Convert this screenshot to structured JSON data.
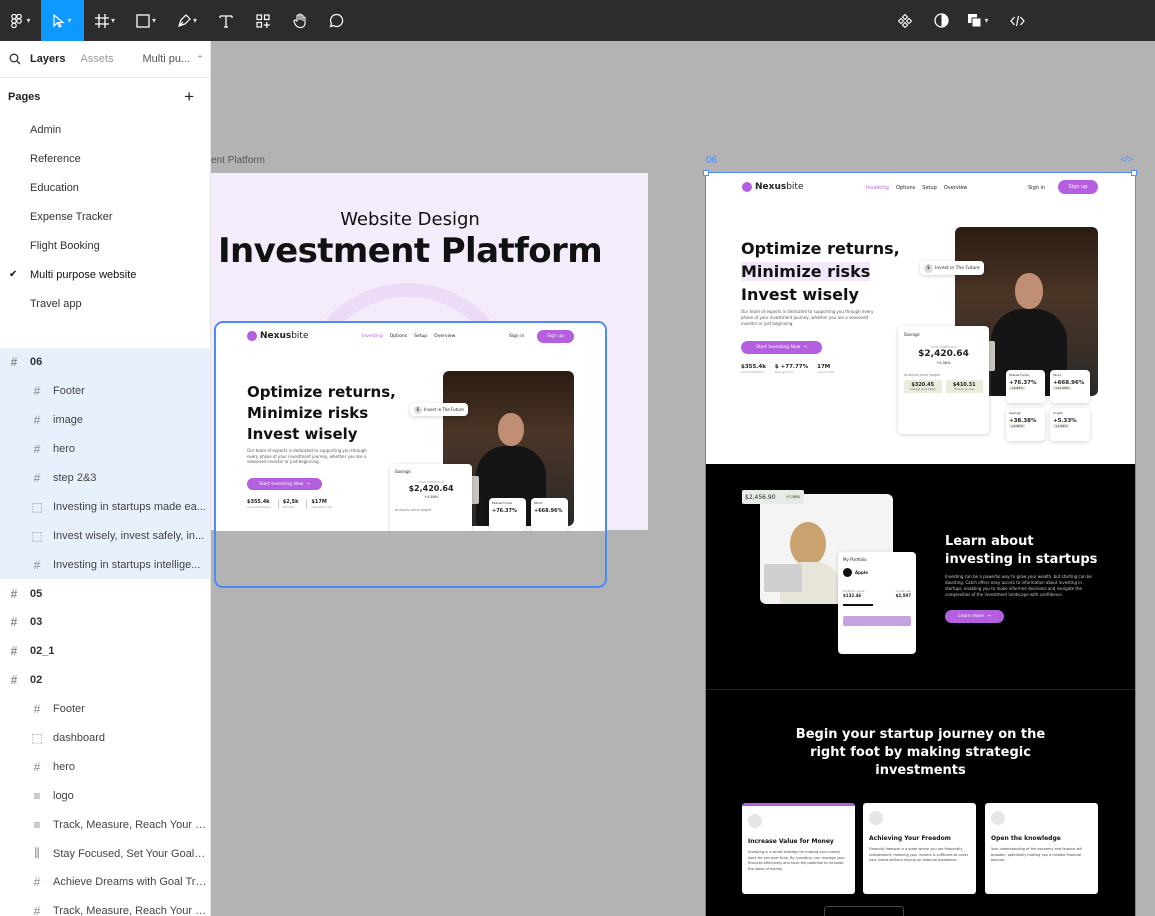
{
  "toolbar": {
    "tools": [
      "main-menu",
      "move",
      "frame",
      "shape",
      "pen",
      "text",
      "resources",
      "hand",
      "comment"
    ],
    "right": [
      "components",
      "contrast",
      "fill",
      "code"
    ]
  },
  "panel": {
    "tabs": {
      "layers": "Layers",
      "assets": "Assets",
      "page": "Multi pu..."
    },
    "pages_title": "Pages",
    "pages": [
      "Admin",
      "Reference",
      "Education",
      "Expense Tracker",
      "Flight Booking",
      "Multi  purpose website",
      "Travel app"
    ],
    "current_page": "Multi  purpose website",
    "layers": [
      {
        "label": "06",
        "level": 0,
        "icon": "#",
        "selected": true
      },
      {
        "label": "Footer",
        "level": 1,
        "icon": "#",
        "selected": true
      },
      {
        "label": "image",
        "level": 1,
        "icon": "#",
        "selected": true
      },
      {
        "label": "hero",
        "level": 1,
        "icon": "#",
        "selected": true
      },
      {
        "label": "step 2&3",
        "level": 1,
        "icon": "#",
        "selected": true
      },
      {
        "label": "Investing in startups made ea...",
        "level": 1,
        "icon": "⬚",
        "selected": true
      },
      {
        "label": "Invest wisely, invest safely, in...",
        "level": 1,
        "icon": "⬚",
        "selected": true
      },
      {
        "label": "Investing in startups intellige...",
        "level": 1,
        "icon": "#",
        "selected": true
      },
      {
        "label": "05",
        "level": 0,
        "icon": "#",
        "selected": false
      },
      {
        "label": "03",
        "level": 0,
        "icon": "#",
        "selected": false
      },
      {
        "label": "02_1",
        "level": 0,
        "icon": "#",
        "selected": false
      },
      {
        "label": "02",
        "level": 0,
        "icon": "#",
        "selected": false
      },
      {
        "label": "Footer",
        "level": 1,
        "icon": "#",
        "selected": false
      },
      {
        "label": "dashboard",
        "level": 1,
        "icon": "⬚",
        "selected": false
      },
      {
        "label": "hero",
        "level": 1,
        "icon": "#",
        "selected": false
      },
      {
        "label": "logo",
        "level": 1,
        "icon": "≡",
        "selected": false
      },
      {
        "label": "Track, Measure, Reach Your G...",
        "level": 1,
        "icon": "≡",
        "selected": false
      },
      {
        "label": "Stay Focused, Set Your Goals,...",
        "level": 1,
        "icon": "⫼",
        "selected": false
      },
      {
        "label": "Achieve Dreams with Goal Tra...",
        "level": 1,
        "icon": "#",
        "selected": false
      },
      {
        "label": "Track, Measure, Reach Your G...",
        "level": 1,
        "icon": "#",
        "selected": false
      },
      {
        "label": "Track Your Goals, Reach Your ...",
        "level": 1,
        "icon": "#",
        "selected": false
      }
    ]
  },
  "canvas": {
    "frame1_label": "ent Platform",
    "frame2_label": "06",
    "code_icon": "</>",
    "cover": {
      "subtitle": "Website Design",
      "title": "Investment Platform"
    }
  },
  "site": {
    "logo_a": "Nexus",
    "logo_b": "bite",
    "nav": [
      "Investing",
      "Options",
      "Setup",
      "Overview"
    ],
    "signin": "Sign in",
    "signup": "Sign up",
    "hero_l1": "Optimize returns,",
    "hero_l2": "Minimize risks",
    "hero_l3": "Invest wisely",
    "hero_body": "Our team of experts is dedicated to supporting you through every phase of your investment journey, whether you are a seasoned investor or just beginning.",
    "cta": "Start Investing Now",
    "stats": [
      {
        "v": "$355.4k",
        "l": "Amount Raised"
      },
      {
        "v": "$2,5k",
        "l": "Portfolio"
      },
      {
        "v": "$17M",
        "l": "Valuation cap"
      }
    ],
    "stats_big": [
      {
        "v": "$355.4k",
        "l": "Amount Raised"
      },
      {
        "v": "$ +77.77%",
        "l": "Mutual Fund"
      },
      {
        "v": "17M",
        "l": "Last month"
      }
    ],
    "tag": "Invest in The Future",
    "savings": {
      "title": "Savings",
      "sub": "YOUR PORTFOLIO",
      "amount": "$2,420.64",
      "change": "+4.56%",
      "analysis": "Analysis price target",
      "p1": "$320.45",
      "p2": "$410.31",
      "p1l": "Average price target",
      "p2l": "Price to income"
    },
    "minis": [
      {
        "t": "Mutual Funds",
        "v": "+76.37%",
        "b": "+4.83%"
      },
      {
        "t": "Stock",
        "v": "+668.96%",
        "b": "+21.26%"
      },
      {
        "t": "Savings",
        "v": "+38.38%",
        "b": "+2.90%"
      },
      {
        "t": "Crypto",
        "v": "+5.33%",
        "b": "+1.56%"
      }
    ],
    "learn": {
      "title1": "Learn about",
      "title2": "investing in startups",
      "body": "Investing can be a powerful way to grow your wealth, but starting can be daunting. Catch offers easy access to information about investing in startups, enabling you to make informed decisions and navigate the complexities of the investment landscape with confidence.",
      "btn": "Learn more",
      "chip": "$2,456.90",
      "chip_b": "+7.56%",
      "portfolio": "My Portfolio",
      "apple": "Apple",
      "pv": "Portfolio value",
      "pvv": "$132.46",
      "pt": "Credit use",
      "ptv": "$2,597"
    },
    "journey": {
      "title1": "Begin your startup journey on the",
      "title2": "right foot by making strategic",
      "title3": "investments"
    },
    "cards": [
      {
        "t": "Increase Value for Money",
        "b": "Investing is a smart strategy for making your money work for you over time. By investing, you manage your finances effectively and have the potential to increase the value of money."
      },
      {
        "t": "Achieving Your Freedom",
        "b": "Financial freedom is a state where you are financially independent, meaning your income is sufficient to cover your needs without relying on external assistance."
      },
      {
        "t": "Open the knowledge",
        "b": "Your understanding of the economy and finance will broaden, potentially making you a reliable financial planner."
      }
    ],
    "colors": {
      "purple": "#b35fe0",
      "dark": "#000000",
      "lavender": "#f4ebfb"
    }
  }
}
